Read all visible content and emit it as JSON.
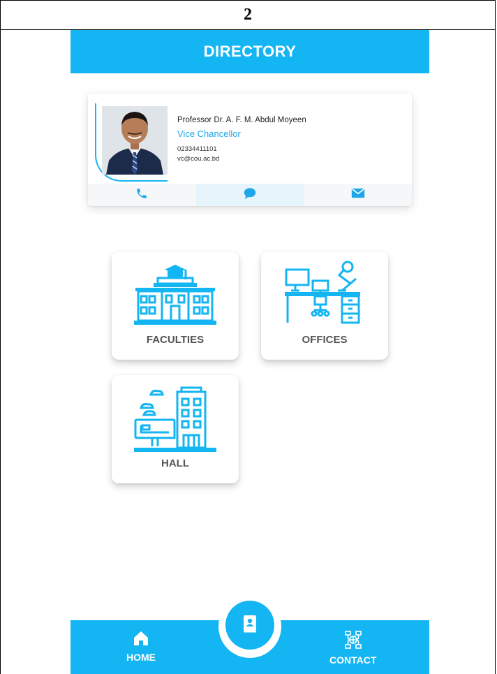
{
  "page": {
    "number": "2"
  },
  "app_bar": {
    "title": "DIRECTORY"
  },
  "profile": {
    "name": "Professor Dr. A. F. M. Abdul Moyeen",
    "title": "Vice Chancellor",
    "phone": "02334411101",
    "email": "vc@cou.ac.bd",
    "actions": [
      "phone-icon",
      "message-icon",
      "mail-icon"
    ]
  },
  "tiles": [
    {
      "label": "FACULTIES",
      "icon": "university-building-icon"
    },
    {
      "label": "OFFICES",
      "icon": "office-desk-icon"
    },
    {
      "label": "HALL",
      "icon": "residence-hall-icon"
    }
  ],
  "bottom_nav": {
    "home_label": "HOME",
    "contact_label": "CONTACT",
    "center_icon": "directory-icon"
  },
  "colors": {
    "accent": "#13b5f2",
    "accent_text": "#1da7e8",
    "label_gray": "#555555"
  }
}
